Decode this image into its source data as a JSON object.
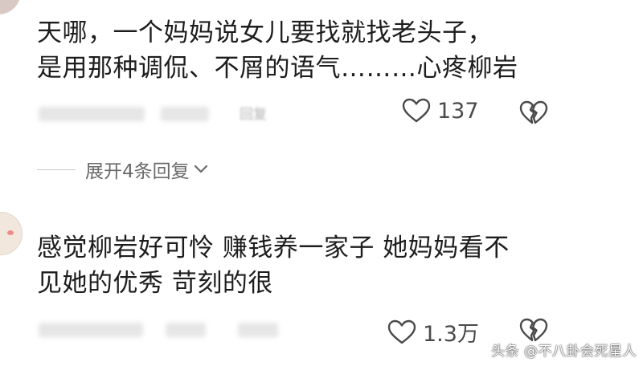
{
  "comments": [
    {
      "lines": [
        "天哪，一个妈妈说女儿要找就找老头子，",
        "是用那种调侃、不屑的语气………心疼柳岩"
      ],
      "meta_reply_label": "回复",
      "likes": "137",
      "like_icon": "heart-outline-icon",
      "dislike_icon": "broken-heart-icon"
    },
    {
      "lines": [
        "感觉柳岩好可怜 赚钱养一家子 她妈妈看不",
        "见她的优秀 苛刻的很"
      ],
      "likes": "1.3万",
      "like_icon": "heart-outline-icon",
      "dislike_icon": "broken-heart-icon"
    }
  ],
  "replies": {
    "expand_label": "展开4条回复"
  },
  "watermark": "头条 @不八卦会死星人",
  "colors": {
    "text": "#1d1d1d",
    "muted": "#6a6a6a",
    "count": "#4a4a4a",
    "background": "#ffffff"
  }
}
